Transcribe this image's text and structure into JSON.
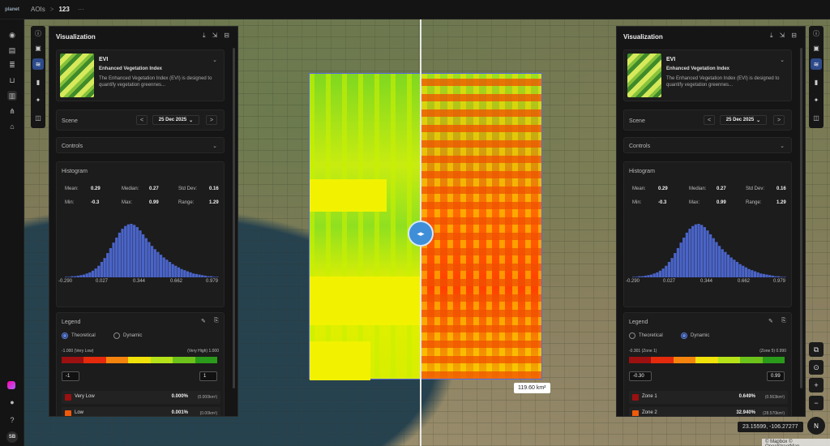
{
  "topbar": {
    "logo": "planet",
    "crumb_root": "AOIs",
    "crumb_sep": ">",
    "crumb_current": "123",
    "more": "···"
  },
  "rail": {
    "avatar": "SB",
    "icons": [
      "compass-icon",
      "inbox-icon",
      "stack-icon",
      "cart-icon",
      "map-icon",
      "workflow-icon",
      "store-icon"
    ]
  },
  "map": {
    "area_label": "119.60 km²",
    "coords": "23.15599, -106.27277",
    "attribution": "© Mapbox © OpenStreetMap",
    "compass": "N",
    "zoom_in": "+",
    "zoom_out": "−"
  },
  "panels": [
    {
      "id": "left",
      "title": "Visualization",
      "index": {
        "name": "EVI",
        "full_name": "Enhanced Vegetation Index",
        "description": "The Enhanced Vegetation Index (EVI) is designed to quantify vegetation greennes..."
      },
      "scene": {
        "label": "Scene",
        "date": "25 Dec 2025",
        "prev": "<",
        "next": ">"
      },
      "controls": {
        "label": "Controls"
      },
      "histogram": {
        "label": "Histogram",
        "mean_label": "Mean:",
        "mean": "0.29",
        "median_label": "Median:",
        "median": "0.27",
        "std_label": "Std Dev:",
        "std": "0.16",
        "min_label": "Min:",
        "min": "-0.3",
        "max_label": "Max:",
        "max": "0.99",
        "range_label": "Range:",
        "range": "1.29",
        "ticks": [
          "-0.290",
          "0.027",
          "0.344",
          "0.662",
          "0.979"
        ]
      },
      "legend": {
        "label": "Legend",
        "mode_a": "Theoretical",
        "mode_b": "Dynamic",
        "selected": "Theoretical",
        "min_text": "-1.000 (Very Low)",
        "max_text": "(Very High) 1.000",
        "min_input": "-1",
        "max_input": "1",
        "rows": [
          {
            "name": "Very Low",
            "pct": "0.000%",
            "area": "(0.000km²)",
            "color": "#9b1010"
          },
          {
            "name": "Low",
            "pct": "0.001%",
            "area": "(0.00km²)",
            "color": "#f05a0a"
          }
        ]
      }
    },
    {
      "id": "right",
      "title": "Visualization",
      "index": {
        "name": "EVI",
        "full_name": "Enhanced Vegetation Index",
        "description": "The Enhanced Vegetation Index (EVI) is designed to quantify vegetation greennes..."
      },
      "scene": {
        "label": "Scene",
        "date": "25 Dec 2025",
        "prev": "<",
        "next": ">"
      },
      "controls": {
        "label": "Controls"
      },
      "histogram": {
        "label": "Histogram",
        "mean_label": "Mean:",
        "mean": "0.29",
        "median_label": "Median:",
        "median": "0.27",
        "std_label": "Std Dev:",
        "std": "0.16",
        "min_label": "Min:",
        "min": "-0.3",
        "max_label": "Max:",
        "max": "0.99",
        "range_label": "Range:",
        "range": "1.29",
        "ticks": [
          "-0.290",
          "0.027",
          "0.344",
          "0.662",
          "0.979"
        ]
      },
      "legend": {
        "label": "Legend",
        "mode_a": "Theoretical",
        "mode_b": "Dynamic",
        "selected": "Dynamic",
        "min_text": "-0.301 (Zone 1)",
        "max_text": "(Zone 5) 0.990",
        "min_input": "-0.30",
        "max_input": "0.99",
        "rows": [
          {
            "name": "Zone 1",
            "pct": "0.649%",
            "area": "(0.563km²)",
            "color": "#9b1010"
          },
          {
            "name": "Zone 2",
            "pct": "32.940%",
            "area": "(28.570km²)",
            "color": "#f05a0a"
          }
        ]
      }
    }
  ],
  "legend_colors": [
    "#9b1010",
    "#e32a0c",
    "#f5840e",
    "#f0e20a",
    "#b6e21a",
    "#6cc21a",
    "#2a9a1a"
  ],
  "histogram_bars": [
    1,
    1,
    2,
    2,
    3,
    4,
    5,
    7,
    9,
    12,
    16,
    21,
    28,
    35,
    44,
    53,
    63,
    72,
    81,
    88,
    93,
    96,
    97,
    95,
    91,
    85,
    78,
    71,
    64,
    57,
    51,
    46,
    41,
    36,
    32,
    28,
    24,
    21,
    18,
    15,
    13,
    11,
    9,
    7,
    6,
    5,
    4,
    3,
    2,
    2,
    1,
    1
  ]
}
